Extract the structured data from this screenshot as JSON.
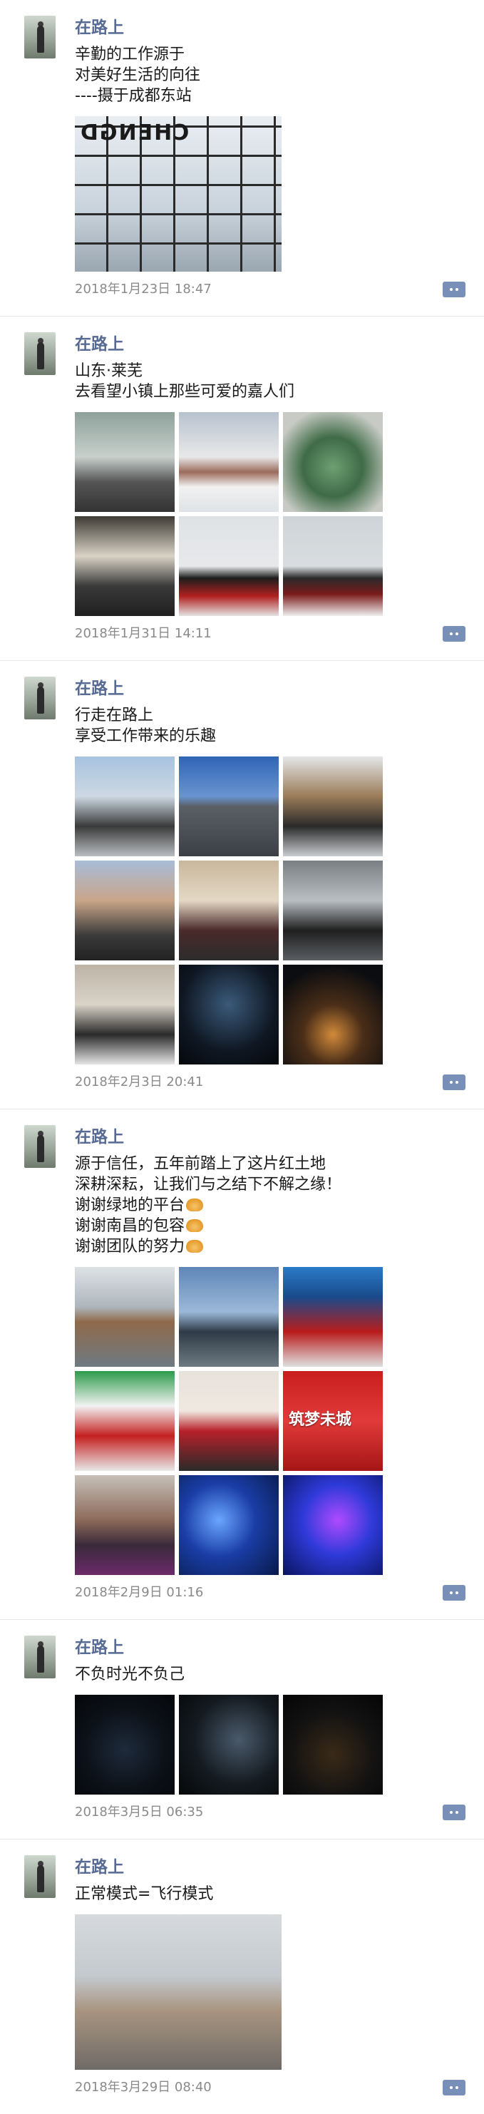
{
  "posts": [
    {
      "username": "在路上",
      "lines": [
        "辛勤的工作源于",
        "对美好生活的向往",
        "----摄于成都东站"
      ],
      "images": [
        {
          "name": "station-glass-photo",
          "texture": "t-glass",
          "overlay": "CHENGD"
        }
      ],
      "layout": "single",
      "time": "2018年1月23日 18:47"
    },
    {
      "username": "在路上",
      "lines": [
        "山东·莱芜",
        "去看望小镇上那些可爱的嘉人们"
      ],
      "images": [
        {
          "name": "road-photo",
          "texture": "t-road"
        },
        {
          "name": "snow-landscape-photo",
          "texture": "t-snow"
        },
        {
          "name": "sand-table-model-photo",
          "texture": "t-model"
        },
        {
          "name": "indoor-group-photo",
          "texture": "t-indoor"
        },
        {
          "name": "outdoor-group-photo-1",
          "texture": "t-group-red"
        },
        {
          "name": "outdoor-group-photo-2",
          "texture": "t-group-snow"
        }
      ],
      "layout": "grid3",
      "time": "2018年1月31日 14:11"
    },
    {
      "username": "在路上",
      "lines": [
        "行走在路上",
        "享受工作带来的乐趣"
      ],
      "images": [
        {
          "name": "stadium-photo",
          "texture": "t-stadium2"
        },
        {
          "name": "tower-photo",
          "texture": "t-tower"
        },
        {
          "name": "security-booth-photo",
          "texture": "t-booth"
        },
        {
          "name": "street-group-photo",
          "texture": "t-street"
        },
        {
          "name": "lobby-group-photo",
          "texture": "t-lobby"
        },
        {
          "name": "gate-group-photo",
          "texture": "t-gate"
        },
        {
          "name": "indoor-visit-photo",
          "texture": "t-hall2"
        },
        {
          "name": "night-tower-photo",
          "texture": "t-night"
        },
        {
          "name": "city-night-aerial-photo",
          "texture": "t-city-night"
        }
      ],
      "layout": "grid3",
      "time": "2018年2月3日 20:41"
    },
    {
      "username": "在路上",
      "lines": [
        "源于信任，五年前踏上了这片红土地",
        "深耕深耘，让我们与之结下不解之缘！",
        "谢谢绿地的平台",
        "谢谢南昌的包容",
        "谢谢团队的努力"
      ],
      "emoji_lines": [
        2,
        3,
        4
      ],
      "images": [
        {
          "name": "airplane-window-photo",
          "texture": "t-airplane"
        },
        {
          "name": "stadium-group-photo",
          "texture": "t-stadium"
        },
        {
          "name": "event-banner-photo",
          "texture": "t-banner"
        },
        {
          "name": "green-stage-photo",
          "texture": "t-green-stage"
        },
        {
          "name": "stage-dance-photo",
          "texture": "t-stage-dance"
        },
        {
          "name": "red-banquet-photo",
          "texture": "t-banquet",
          "overlay": "筑梦未城"
        },
        {
          "name": "hall-performance-photo",
          "texture": "t-hall"
        },
        {
          "name": "blue-stage-photo",
          "texture": "t-blue-stage"
        },
        {
          "name": "blue-show-photo",
          "texture": "t-blue-show"
        }
      ],
      "layout": "grid3",
      "time": "2018年2月9日 01:16"
    },
    {
      "username": "在路上",
      "lines": [
        "不负时光不负己"
      ],
      "images": [
        {
          "name": "car-interior-photo-1",
          "texture": "t-car"
        },
        {
          "name": "car-interior-photo-2",
          "texture": "t-car2"
        },
        {
          "name": "car-interior-photo-3",
          "texture": "t-car3"
        }
      ],
      "layout": "grid3",
      "time": "2018年3月5日 06:35"
    },
    {
      "username": "在路上",
      "lines": [
        "正常模式=飞行模式"
      ],
      "images": [
        {
          "name": "runway-window-photo",
          "texture": "t-runway"
        }
      ],
      "layout": "tall",
      "time": "2018年3月29日 08:40"
    }
  ],
  "colors": {
    "username": "#576b95",
    "time": "#8a8a8a",
    "comment_button": "#7890b8"
  },
  "icons": {
    "comment": "comment-dots-icon",
    "emoji": "clapping-hands-icon"
  }
}
